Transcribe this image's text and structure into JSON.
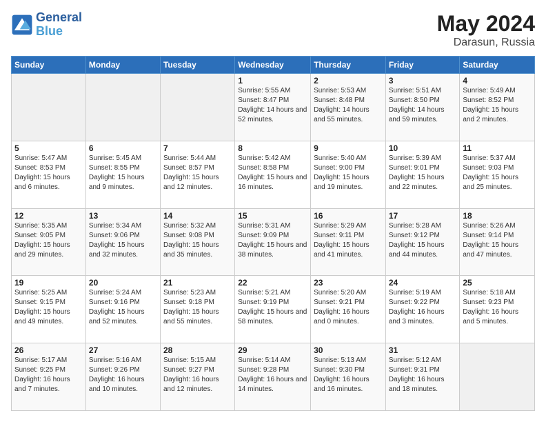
{
  "header": {
    "logo_line1": "General",
    "logo_line2": "Blue",
    "month": "May 2024",
    "location": "Darasun, Russia"
  },
  "weekdays": [
    "Sunday",
    "Monday",
    "Tuesday",
    "Wednesday",
    "Thursday",
    "Friday",
    "Saturday"
  ],
  "weeks": [
    [
      {
        "day": "",
        "sunrise": "",
        "sunset": "",
        "daylight": "",
        "empty": true
      },
      {
        "day": "",
        "sunrise": "",
        "sunset": "",
        "daylight": "",
        "empty": true
      },
      {
        "day": "",
        "sunrise": "",
        "sunset": "",
        "daylight": "",
        "empty": true
      },
      {
        "day": "1",
        "sunrise": "Sunrise: 5:55 AM",
        "sunset": "Sunset: 8:47 PM",
        "daylight": "Daylight: 14 hours and 52 minutes.",
        "empty": false
      },
      {
        "day": "2",
        "sunrise": "Sunrise: 5:53 AM",
        "sunset": "Sunset: 8:48 PM",
        "daylight": "Daylight: 14 hours and 55 minutes.",
        "empty": false
      },
      {
        "day": "3",
        "sunrise": "Sunrise: 5:51 AM",
        "sunset": "Sunset: 8:50 PM",
        "daylight": "Daylight: 14 hours and 59 minutes.",
        "empty": false
      },
      {
        "day": "4",
        "sunrise": "Sunrise: 5:49 AM",
        "sunset": "Sunset: 8:52 PM",
        "daylight": "Daylight: 15 hours and 2 minutes.",
        "empty": false
      }
    ],
    [
      {
        "day": "5",
        "sunrise": "Sunrise: 5:47 AM",
        "sunset": "Sunset: 8:53 PM",
        "daylight": "Daylight: 15 hours and 6 minutes.",
        "empty": false
      },
      {
        "day": "6",
        "sunrise": "Sunrise: 5:45 AM",
        "sunset": "Sunset: 8:55 PM",
        "daylight": "Daylight: 15 hours and 9 minutes.",
        "empty": false
      },
      {
        "day": "7",
        "sunrise": "Sunrise: 5:44 AM",
        "sunset": "Sunset: 8:57 PM",
        "daylight": "Daylight: 15 hours and 12 minutes.",
        "empty": false
      },
      {
        "day": "8",
        "sunrise": "Sunrise: 5:42 AM",
        "sunset": "Sunset: 8:58 PM",
        "daylight": "Daylight: 15 hours and 16 minutes.",
        "empty": false
      },
      {
        "day": "9",
        "sunrise": "Sunrise: 5:40 AM",
        "sunset": "Sunset: 9:00 PM",
        "daylight": "Daylight: 15 hours and 19 minutes.",
        "empty": false
      },
      {
        "day": "10",
        "sunrise": "Sunrise: 5:39 AM",
        "sunset": "Sunset: 9:01 PM",
        "daylight": "Daylight: 15 hours and 22 minutes.",
        "empty": false
      },
      {
        "day": "11",
        "sunrise": "Sunrise: 5:37 AM",
        "sunset": "Sunset: 9:03 PM",
        "daylight": "Daylight: 15 hours and 25 minutes.",
        "empty": false
      }
    ],
    [
      {
        "day": "12",
        "sunrise": "Sunrise: 5:35 AM",
        "sunset": "Sunset: 9:05 PM",
        "daylight": "Daylight: 15 hours and 29 minutes.",
        "empty": false
      },
      {
        "day": "13",
        "sunrise": "Sunrise: 5:34 AM",
        "sunset": "Sunset: 9:06 PM",
        "daylight": "Daylight: 15 hours and 32 minutes.",
        "empty": false
      },
      {
        "day": "14",
        "sunrise": "Sunrise: 5:32 AM",
        "sunset": "Sunset: 9:08 PM",
        "daylight": "Daylight: 15 hours and 35 minutes.",
        "empty": false
      },
      {
        "day": "15",
        "sunrise": "Sunrise: 5:31 AM",
        "sunset": "Sunset: 9:09 PM",
        "daylight": "Daylight: 15 hours and 38 minutes.",
        "empty": false
      },
      {
        "day": "16",
        "sunrise": "Sunrise: 5:29 AM",
        "sunset": "Sunset: 9:11 PM",
        "daylight": "Daylight: 15 hours and 41 minutes.",
        "empty": false
      },
      {
        "day": "17",
        "sunrise": "Sunrise: 5:28 AM",
        "sunset": "Sunset: 9:12 PM",
        "daylight": "Daylight: 15 hours and 44 minutes.",
        "empty": false
      },
      {
        "day": "18",
        "sunrise": "Sunrise: 5:26 AM",
        "sunset": "Sunset: 9:14 PM",
        "daylight": "Daylight: 15 hours and 47 minutes.",
        "empty": false
      }
    ],
    [
      {
        "day": "19",
        "sunrise": "Sunrise: 5:25 AM",
        "sunset": "Sunset: 9:15 PM",
        "daylight": "Daylight: 15 hours and 49 minutes.",
        "empty": false
      },
      {
        "day": "20",
        "sunrise": "Sunrise: 5:24 AM",
        "sunset": "Sunset: 9:16 PM",
        "daylight": "Daylight: 15 hours and 52 minutes.",
        "empty": false
      },
      {
        "day": "21",
        "sunrise": "Sunrise: 5:23 AM",
        "sunset": "Sunset: 9:18 PM",
        "daylight": "Daylight: 15 hours and 55 minutes.",
        "empty": false
      },
      {
        "day": "22",
        "sunrise": "Sunrise: 5:21 AM",
        "sunset": "Sunset: 9:19 PM",
        "daylight": "Daylight: 15 hours and 58 minutes.",
        "empty": false
      },
      {
        "day": "23",
        "sunrise": "Sunrise: 5:20 AM",
        "sunset": "Sunset: 9:21 PM",
        "daylight": "Daylight: 16 hours and 0 minutes.",
        "empty": false
      },
      {
        "day": "24",
        "sunrise": "Sunrise: 5:19 AM",
        "sunset": "Sunset: 9:22 PM",
        "daylight": "Daylight: 16 hours and 3 minutes.",
        "empty": false
      },
      {
        "day": "25",
        "sunrise": "Sunrise: 5:18 AM",
        "sunset": "Sunset: 9:23 PM",
        "daylight": "Daylight: 16 hours and 5 minutes.",
        "empty": false
      }
    ],
    [
      {
        "day": "26",
        "sunrise": "Sunrise: 5:17 AM",
        "sunset": "Sunset: 9:25 PM",
        "daylight": "Daylight: 16 hours and 7 minutes.",
        "empty": false
      },
      {
        "day": "27",
        "sunrise": "Sunrise: 5:16 AM",
        "sunset": "Sunset: 9:26 PM",
        "daylight": "Daylight: 16 hours and 10 minutes.",
        "empty": false
      },
      {
        "day": "28",
        "sunrise": "Sunrise: 5:15 AM",
        "sunset": "Sunset: 9:27 PM",
        "daylight": "Daylight: 16 hours and 12 minutes.",
        "empty": false
      },
      {
        "day": "29",
        "sunrise": "Sunrise: 5:14 AM",
        "sunset": "Sunset: 9:28 PM",
        "daylight": "Daylight: 16 hours and 14 minutes.",
        "empty": false
      },
      {
        "day": "30",
        "sunrise": "Sunrise: 5:13 AM",
        "sunset": "Sunset: 9:30 PM",
        "daylight": "Daylight: 16 hours and 16 minutes.",
        "empty": false
      },
      {
        "day": "31",
        "sunrise": "Sunrise: 5:12 AM",
        "sunset": "Sunset: 9:31 PM",
        "daylight": "Daylight: 16 hours and 18 minutes.",
        "empty": false
      },
      {
        "day": "",
        "sunrise": "",
        "sunset": "",
        "daylight": "",
        "empty": true
      }
    ]
  ]
}
